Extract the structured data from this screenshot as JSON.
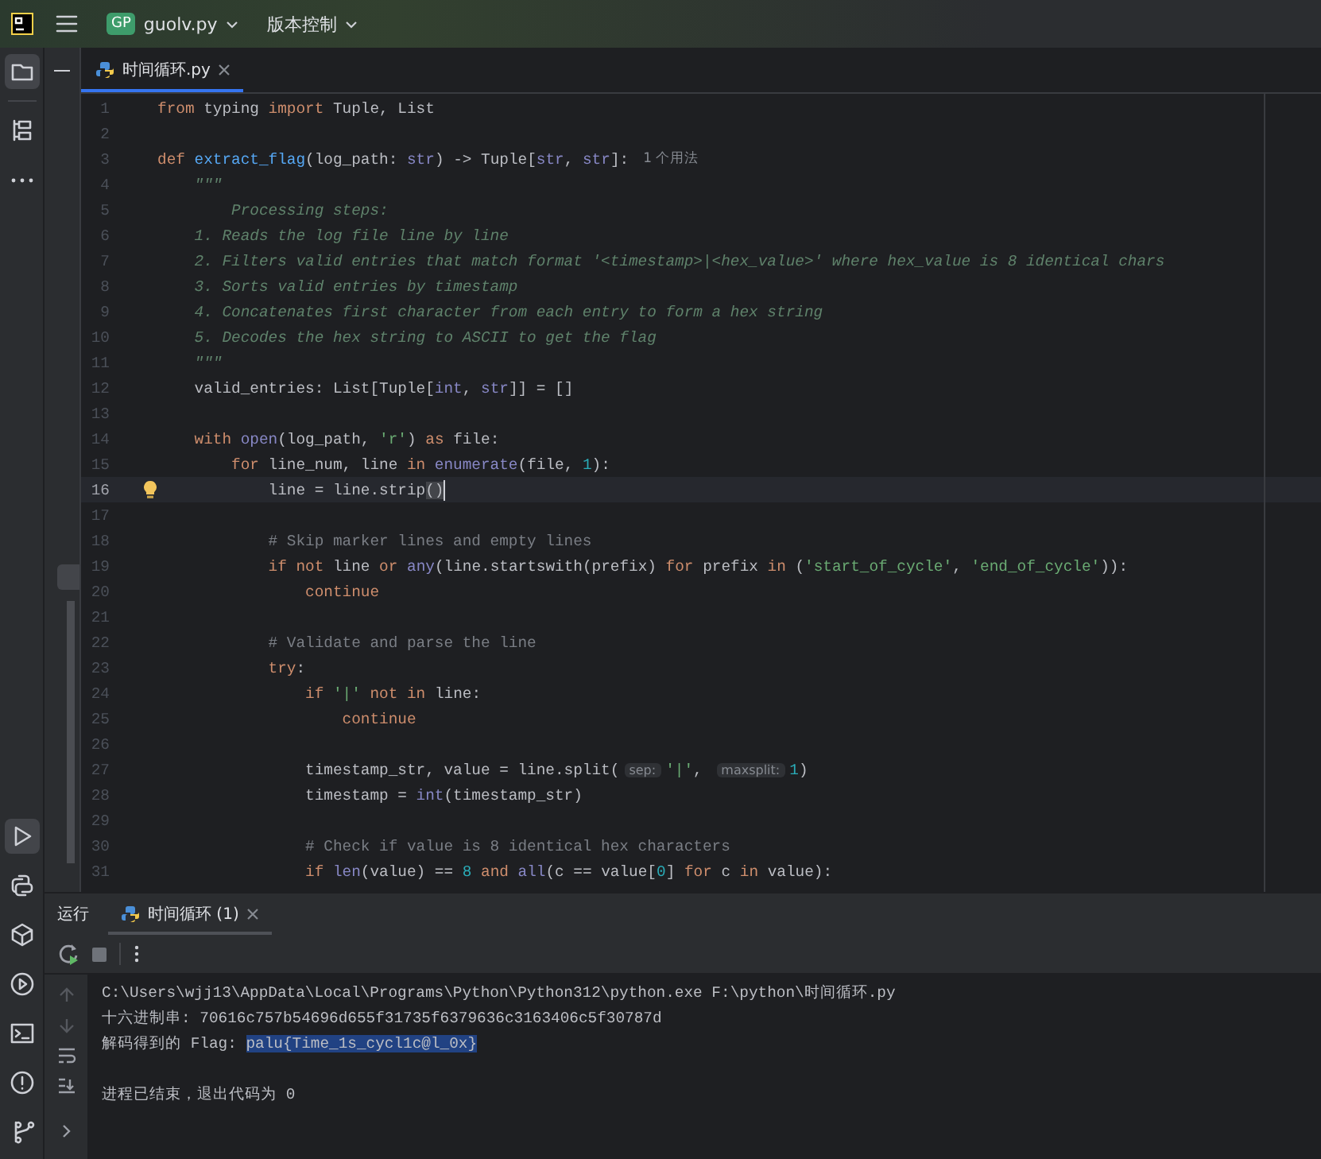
{
  "top_bar": {
    "project_badge": "GP",
    "project": "guolv.py",
    "vcs": "版本控制"
  },
  "left_toolbar": {
    "top": [
      {
        "kind": "folder",
        "selected": true
      },
      {
        "kind": "structure",
        "selected": false
      },
      {
        "kind": "more",
        "selected": false
      }
    ],
    "bottom": [
      {
        "kind": "run",
        "selected": true
      },
      {
        "kind": "python",
        "selected": false
      },
      {
        "kind": "packages",
        "selected": false
      },
      {
        "kind": "services",
        "selected": false
      },
      {
        "kind": "terminal",
        "selected": false
      },
      {
        "kind": "problems",
        "selected": false
      },
      {
        "kind": "git",
        "selected": false
      }
    ]
  },
  "editor": {
    "tabs": [
      {
        "label": "时间循环.py",
        "selected": true
      }
    ],
    "lines": [
      {
        "number": "1",
        "tokens": [
          {
            "text": "from",
            "kind": "kw"
          },
          {
            "text": " typing ",
            "kind": "plain"
          },
          {
            "text": "import",
            "kind": "kw"
          },
          {
            "text": " Tuple, List",
            "kind": "plain"
          }
        ]
      },
      {
        "number": "2"
      },
      {
        "number": "3",
        "tokens": [
          {
            "text": "def ",
            "kind": "kw"
          },
          {
            "text": "extract_flag",
            "kind": "fn"
          },
          {
            "text": "(log_path: ",
            "kind": "plain"
          },
          {
            "text": "str",
            "kind": "builtin"
          },
          {
            "text": ") -> Tuple[",
            "kind": "plain"
          },
          {
            "text": "str",
            "kind": "builtin"
          },
          {
            "text": ", ",
            "kind": "plain"
          },
          {
            "text": "str",
            "kind": "builtin"
          },
          {
            "text": "]:",
            "kind": "plain"
          },
          {
            "text": "1 个用法",
            "kind": "usage"
          }
        ]
      },
      {
        "number": "4",
        "tokens": [
          {
            "text": "    \"\"\"",
            "kind": "doc"
          }
        ]
      },
      {
        "number": "5",
        "tokens": [
          {
            "text": "        Processing steps:",
            "kind": "doc"
          }
        ]
      },
      {
        "number": "6",
        "tokens": [
          {
            "text": "    1. Reads the log file line by line",
            "kind": "doc"
          }
        ]
      },
      {
        "number": "7",
        "tokens": [
          {
            "text": "    2. Filters valid entries that match format '<timestamp>|<hex_value>' where hex_value is 8 identical chars",
            "kind": "doc"
          }
        ]
      },
      {
        "number": "8",
        "tokens": [
          {
            "text": "    3. Sorts valid entries by timestamp",
            "kind": "doc"
          }
        ]
      },
      {
        "number": "9",
        "tokens": [
          {
            "text": "    4. Concatenates first character from each entry to form a hex string",
            "kind": "doc"
          }
        ]
      },
      {
        "number": "10",
        "tokens": [
          {
            "text": "    5. Decodes the hex string to ASCII to get the flag",
            "kind": "doc"
          }
        ]
      },
      {
        "number": "11",
        "tokens": [
          {
            "text": "    \"\"\"",
            "kind": "doc"
          }
        ]
      },
      {
        "number": "12",
        "tokens": [
          {
            "text": "    valid_entries: List[Tuple[",
            "kind": "plain"
          },
          {
            "text": "int",
            "kind": "builtin"
          },
          {
            "text": ", ",
            "kind": "plain"
          },
          {
            "text": "str",
            "kind": "builtin"
          },
          {
            "text": "]] = []",
            "kind": "plain"
          }
        ]
      },
      {
        "number": "13"
      },
      {
        "number": "14",
        "tokens": [
          {
            "text": "    with ",
            "kind": "kw"
          },
          {
            "text": "open",
            "kind": "builtin"
          },
          {
            "text": "(log_path, ",
            "kind": "plain"
          },
          {
            "text": "'r'",
            "kind": "str"
          },
          {
            "text": ") ",
            "kind": "plain"
          },
          {
            "text": "as",
            "kind": "kw"
          },
          {
            "text": " file:",
            "kind": "plain"
          }
        ]
      },
      {
        "number": "15",
        "tokens": [
          {
            "text": "        for",
            "kind": "kw"
          },
          {
            "text": " line_num, line ",
            "kind": "plain"
          },
          {
            "text": "in ",
            "kind": "kw"
          },
          {
            "text": "enumerate",
            "kind": "builtin"
          },
          {
            "text": "(file, ",
            "kind": "plain"
          },
          {
            "text": "1",
            "kind": "num"
          },
          {
            "text": "):",
            "kind": "plain"
          }
        ]
      },
      {
        "number": "16",
        "current": true,
        "bulb": true,
        "caret": true,
        "tokens": [
          {
            "text": "            line = line.strip",
            "kind": "plain"
          },
          {
            "text": "()",
            "kind": "match"
          }
        ]
      },
      {
        "number": "17"
      },
      {
        "number": "18",
        "tokens": [
          {
            "text": "            # Skip marker lines and empty lines",
            "kind": "cmt"
          }
        ]
      },
      {
        "number": "19",
        "tokens": [
          {
            "text": "            if not",
            "kind": "kw"
          },
          {
            "text": " line ",
            "kind": "plain"
          },
          {
            "text": "or ",
            "kind": "kw"
          },
          {
            "text": "any",
            "kind": "builtin"
          },
          {
            "text": "(line.startswith(prefix) ",
            "kind": "plain"
          },
          {
            "text": "for",
            "kind": "kw"
          },
          {
            "text": " prefix ",
            "kind": "plain"
          },
          {
            "text": "in",
            "kind": "kw"
          },
          {
            "text": " (",
            "kind": "plain"
          },
          {
            "text": "'start_of_cycle'",
            "kind": "str"
          },
          {
            "text": ", ",
            "kind": "plain"
          },
          {
            "text": "'end_of_cycle'",
            "kind": "str"
          },
          {
            "text": ")):",
            "kind": "plain"
          }
        ]
      },
      {
        "number": "20",
        "tokens": [
          {
            "text": "                continue",
            "kind": "kw"
          }
        ]
      },
      {
        "number": "21"
      },
      {
        "number": "22",
        "tokens": [
          {
            "text": "            # Validate and parse the line",
            "kind": "cmt"
          }
        ]
      },
      {
        "number": "23",
        "tokens": [
          {
            "text": "            try",
            "kind": "kw"
          },
          {
            "text": ":",
            "kind": "plain"
          }
        ]
      },
      {
        "number": "24",
        "tokens": [
          {
            "text": "                if ",
            "kind": "kw"
          },
          {
            "text": "'|'",
            "kind": "str"
          },
          {
            "text": " not in",
            "kind": "kw"
          },
          {
            "text": " line:",
            "kind": "plain"
          }
        ]
      },
      {
        "number": "25",
        "tokens": [
          {
            "text": "                    continue",
            "kind": "kw"
          }
        ]
      },
      {
        "number": "26"
      },
      {
        "number": "27",
        "tokens": [
          {
            "text": "                timestamp_str, value = line.split(",
            "kind": "plain"
          },
          {
            "text": "sep:",
            "kind": "hint"
          },
          {
            "text": "'|'",
            "kind": "str"
          },
          {
            "text": ", ",
            "kind": "plain"
          },
          {
            "text": "maxsplit:",
            "kind": "hint"
          },
          {
            "text": "1",
            "kind": "num"
          },
          {
            "text": ")",
            "kind": "plain"
          }
        ]
      },
      {
        "number": "28",
        "tokens": [
          {
            "text": "                timestamp = ",
            "kind": "plain"
          },
          {
            "text": "int",
            "kind": "builtin"
          },
          {
            "text": "(timestamp_str)",
            "kind": "plain"
          }
        ]
      },
      {
        "number": "29"
      },
      {
        "number": "30",
        "tokens": [
          {
            "text": "                # Check if value is 8 identical hex characters",
            "kind": "cmt"
          }
        ]
      },
      {
        "number": "31",
        "tokens": [
          {
            "text": "                if ",
            "kind": "kw"
          },
          {
            "text": "len",
            "kind": "builtin"
          },
          {
            "text": "(value) == ",
            "kind": "plain"
          },
          {
            "text": "8",
            "kind": "num"
          },
          {
            "text": " and ",
            "kind": "kw"
          },
          {
            "text": "all",
            "kind": "builtin"
          },
          {
            "text": "(c == value[",
            "kind": "plain"
          },
          {
            "text": "0",
            "kind": "num"
          },
          {
            "text": "] ",
            "kind": "plain"
          },
          {
            "text": "for",
            "kind": "kw"
          },
          {
            "text": " c ",
            "kind": "plain"
          },
          {
            "text": "in",
            "kind": "kw"
          },
          {
            "text": " value):",
            "kind": "plain"
          }
        ]
      }
    ]
  },
  "run_panel": {
    "title": "运行",
    "tabs": [
      {
        "label": "时间循环 (1)",
        "selected": true
      }
    ],
    "console": [
      {
        "kind": "command",
        "parts": [
          {
            "text": "C:\\Users\\wjj13\\AppData\\Local\\Programs\\Python\\Python312\\python.exe F:\\python\\时间循环.py",
            "selected": false
          }
        ]
      },
      {
        "kind": "output",
        "parts": [
          {
            "text": "十六进制串: 70616c757b54696d655f31735f6379636c3163406c5f30787d",
            "selected": false
          }
        ]
      },
      {
        "kind": "output",
        "parts": [
          {
            "text": "解码得到的 Flag: ",
            "selected": false
          },
          {
            "text": "palu{Time_1s_cycl1c@l_0x}",
            "selected": true
          }
        ]
      },
      {
        "kind": "exit",
        "parts": [
          {
            "text": "进程已结束，退出代码为 0",
            "selected": false
          }
        ]
      }
    ]
  }
}
